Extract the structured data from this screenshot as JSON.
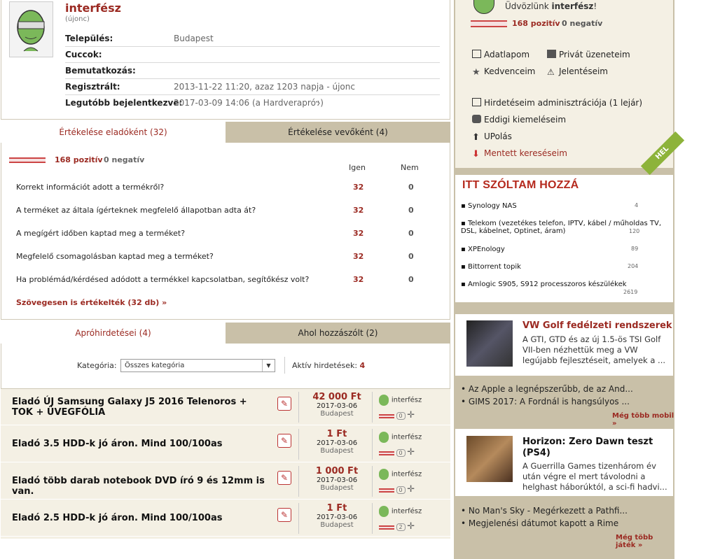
{
  "profile": {
    "username": "interfész",
    "role": "(újonc)",
    "rows": [
      {
        "key": "Település:",
        "value": "Budapest"
      },
      {
        "key": "Cuccok:",
        "value": ""
      },
      {
        "key": "Bemutatkozás:",
        "value": ""
      },
      {
        "key": "Regisztrált:",
        "value": "2013-11-22 11:20, azaz 1203 napja - újonc"
      },
      {
        "key": "Legutóbb bejelentkezve:",
        "value": "2017-03-09 14:06 (a Hardverapróን)"
      }
    ]
  },
  "rating_tabs": {
    "seller": "Értékelése eladóként (32)",
    "buyer": "Értékelése vevőként (4)"
  },
  "rating": {
    "positive": "168 pozitív",
    "negative": "0 negatív",
    "col_yes": "Igen",
    "col_no": "Nem",
    "questions": [
      {
        "q": "Korrekt információt adott a termékről?",
        "yes": "32",
        "no": "0"
      },
      {
        "q": "A terméket az általa ígérteknek megfelelő állapotban adta át?",
        "yes": "32",
        "no": "0"
      },
      {
        "q": "A megígért időben kaptad meg a terméket?",
        "yes": "32",
        "no": "0"
      },
      {
        "q": "Megfelelő csomagolásban kaptad meg a terméket?",
        "yes": "32",
        "no": "0"
      },
      {
        "q": "Ha problémád/kérdésed adódott a termékkel kapcsolatban, segítőkész volt?",
        "yes": "32",
        "no": "0"
      }
    ],
    "text_reviews": "Szövegesen is értékelték (32 db)"
  },
  "ads_tabs": {
    "ads": "Apróhirdetései (4)",
    "comments": "Ahol hozzászólt (2)"
  },
  "filter": {
    "label": "Kategória:",
    "selected": "Összes kategória",
    "active_label": "Aktív hirdetések:",
    "active_count": "4"
  },
  "ads": [
    {
      "title": "Eladó ÚJ Samsung Galaxy J5 2016 Telenoros + TOK + ÜVEGFÓLIA",
      "price": "42 000 Ft",
      "date": "2017-03-06",
      "city": "Budapest",
      "seller": "interfész",
      "count": "0"
    },
    {
      "title": "Eladó 3.5 HDD-k jó áron. Mind 100/100as",
      "price": "1 Ft",
      "date": "2017-03-06",
      "city": "Budapest",
      "seller": "interfész",
      "count": "0"
    },
    {
      "title": "Eladó több darab notebook DVD író 9 és 12mm is van.",
      "price": "1 000 Ft",
      "date": "2017-03-06",
      "city": "Budapest",
      "seller": "interfész",
      "count": "0"
    },
    {
      "title": "Eladó 2.5 HDD-k jó áron. Mind 100/100as",
      "price": "1 Ft",
      "date": "2017-03-06",
      "city": "Budapest",
      "seller": "interfész",
      "count": "2"
    }
  ],
  "sidebar": {
    "welcome_prefix": "Üdvözlünk ",
    "welcome_name": "interfész",
    "welcome_suffix": "!",
    "positive": "168 pozitív",
    "negative": "0 negatív",
    "menu": [
      {
        "label": "Adatlapom",
        "icon": "profile-icon"
      },
      {
        "label": "Privát üzeneteim",
        "icon": "envelope-icon"
      },
      {
        "label": "Kedvenceim",
        "icon": "star-icon"
      },
      {
        "label": "Jelentéseim",
        "icon": "warning-icon"
      },
      {
        "label": "Hirdetéseim adminisztrációja (1 lejár)",
        "icon": "document-icon"
      },
      {
        "label": "Eddigi kiemeléseim",
        "icon": "coins-icon"
      },
      {
        "label": "UPolás",
        "icon": "up-arrow-icon"
      },
      {
        "label": "Mentett kereséseim",
        "icon": "download-icon"
      }
    ],
    "corner_badge": "HEL",
    "hozza_title": "ITT SZÓLTAM HOZZÁ",
    "topics": [
      {
        "title": "Synology NAS",
        "count": "4"
      },
      {
        "title": "Telekom (vezetékes telefon, IPTV, kábel / műholdas TV, DSL, kábelnet, Optinet, áram)",
        "count": "120"
      },
      {
        "title": "XPEnology",
        "count": "89"
      },
      {
        "title": "Bittorrent topik",
        "count": "204"
      },
      {
        "title": "Amlogic S905, S912 processzoros készülékek",
        "count": "2619"
      }
    ],
    "news1": {
      "title": "VW Golf fedélzeti rendszerek",
      "desc": "A GTI, GTD és az új 1.5-ös TSI Golf VII-ben nézhettük meg a VW legújabb fejlesztéseit, amelyek a ..."
    },
    "links1": [
      "Az Apple a legnépszerűbb, de az And...",
      "GIMS 2017: A Fordnál is hangsúlyos ..."
    ],
    "more1": "Még több mobil »",
    "news2": {
      "title": "Horizon: Zero Dawn teszt (PS4)",
      "desc": "A Guerrilla Games tizenhárom év után végre el mert távolodni a helghast háborúktól, a sci-fi hadvi..."
    },
    "links2": [
      "No Man's Sky - Megérkezett a Pathfi...",
      "Megjelenési dátumot kapott a Rime"
    ],
    "more2": "Még több játék »"
  }
}
